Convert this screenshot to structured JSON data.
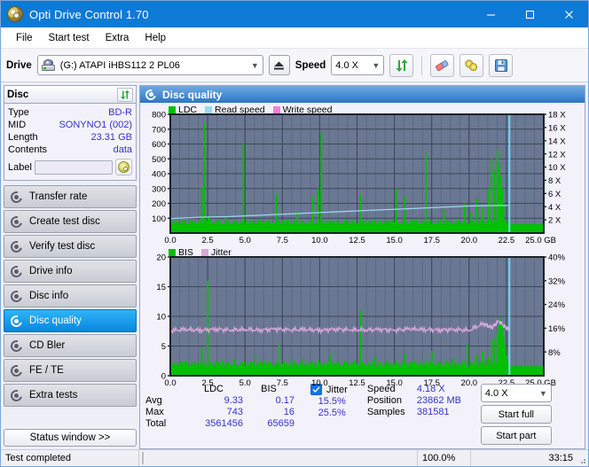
{
  "window": {
    "title": "Opti Drive Control 1.70",
    "icon": "disc-icon",
    "controls": {
      "minimize": "minimize-icon",
      "maximize": "maximize-icon",
      "close": "close-icon"
    }
  },
  "menubar": {
    "items": [
      "File",
      "Start test",
      "Extra",
      "Help"
    ]
  },
  "toolbar": {
    "drive_label": "Drive",
    "drive_value": "(G:)   ATAPI iHBS112  2 PL06",
    "eject_icon": "eject-icon",
    "speed_label": "Speed",
    "speed_value": "4.0 X",
    "refresh_icon": "refresh-icon",
    "eraser_icon": "eraser-icon",
    "settings_icon": "settings-icon",
    "save_icon": "save-icon"
  },
  "sidebar": {
    "disc_panel": {
      "title": "Disc",
      "refresh_icon": "refresh-icon",
      "rows": [
        {
          "key": "Type",
          "value": "BD-R"
        },
        {
          "key": "MID",
          "value": "SONYNO1 (002)"
        },
        {
          "key": "Length",
          "value": "23.31 GB"
        },
        {
          "key": "Contents",
          "value": "data"
        }
      ],
      "label_key": "Label",
      "label_value": "",
      "label_button_icon": "cd-icon"
    },
    "nav": [
      {
        "label": "Transfer rate",
        "icon": "disc-test-icon",
        "active": false
      },
      {
        "label": "Create test disc",
        "icon": "disc-test-icon",
        "active": false
      },
      {
        "label": "Verify test disc",
        "icon": "disc-test-icon",
        "active": false
      },
      {
        "label": "Drive info",
        "icon": "disc-test-icon",
        "active": false
      },
      {
        "label": "Disc info",
        "icon": "disc-test-icon",
        "active": false
      },
      {
        "label": "Disc quality",
        "icon": "disc-test-icon",
        "active": true
      },
      {
        "label": "CD Bler",
        "icon": "disc-test-icon",
        "active": false
      },
      {
        "label": "FE / TE",
        "icon": "disc-test-icon",
        "active": false
      },
      {
        "label": "Extra tests",
        "icon": "disc-test-icon",
        "active": false
      }
    ],
    "status_window_button": "Status window >>"
  },
  "panel": {
    "title": "Disc quality",
    "icon": "disc-test-icon"
  },
  "stats": {
    "col_headers": [
      "LDC",
      "BIS"
    ],
    "rows": [
      {
        "label": "Avg",
        "ldc": "9.33",
        "bis": "0.17"
      },
      {
        "label": "Max",
        "ldc": "743",
        "bis": "16"
      },
      {
        "label": "Total",
        "ldc": "3561456",
        "bis": "65659"
      }
    ],
    "jitter": {
      "label": "Jitter",
      "checked": true,
      "avg": "15.5%",
      "max": "25.5%"
    },
    "speed": {
      "key": "Speed",
      "value": "4.18 X"
    },
    "position": {
      "key": "Position",
      "value": "23862 MB"
    },
    "samples": {
      "key": "Samples",
      "value": "381581"
    },
    "speed_select": "4.0 X",
    "start_full": "Start full",
    "start_part": "Start part"
  },
  "statusbar": {
    "text": "Test completed",
    "percent": "100.0%",
    "progress_value": 100,
    "time": "33:15"
  },
  "colors": {
    "accent": "#0d7ad6",
    "ldc_green": "#00c000",
    "read_speed": "#9bd7f0",
    "write_speed": "#ff7ad9",
    "bis_green": "#00c000",
    "jitter_pink": "#d9a8d8",
    "plot_bg": "#6b7893",
    "grid": "#566176",
    "value_blue": "#3333cc",
    "progress_green": "#14b514"
  },
  "chart_data": [
    {
      "type": "line",
      "title": "Disc quality - LDC",
      "xlabel": "GB",
      "ylabel": "LDC",
      "xlim": [
        0,
        25
      ],
      "ylim": [
        0,
        800
      ],
      "xticks": [
        "0.0",
        "2.5",
        "5.0",
        "7.5",
        "10.0",
        "12.5",
        "15.0",
        "17.5",
        "20.0",
        "22.5",
        "25.0 GB"
      ],
      "yticks": [
        100,
        200,
        300,
        400,
        500,
        600,
        700,
        800
      ],
      "y2label": "Speed",
      "y2lim": [
        0,
        18
      ],
      "y2ticks": [
        "2 X",
        "4 X",
        "6 X",
        "8 X",
        "10 X",
        "12 X",
        "14 X",
        "16 X",
        "18 X"
      ],
      "grid": true,
      "legend": [
        {
          "name": "LDC",
          "color": "#00c000"
        },
        {
          "name": "Read speed",
          "color": "#9bd7f0"
        },
        {
          "name": "Write speed",
          "color": "#ff7ad9"
        }
      ],
      "series": [
        {
          "name": "LDC",
          "color": "#00c000",
          "kind": "spikes",
          "baseline": 60,
          "x": [
            0.1,
            0.3,
            0.5,
            0.7,
            0.9,
            1.1,
            1.3,
            1.5,
            1.7,
            1.9,
            2.1,
            2.25,
            2.4,
            2.55,
            2.7,
            2.9,
            3.1,
            3.3,
            3.5,
            3.7,
            3.9,
            4.1,
            4.3,
            4.5,
            4.7,
            4.9,
            5.1,
            5.3,
            5.5,
            5.7,
            5.9,
            6.1,
            6.3,
            6.5,
            6.7,
            6.9,
            7.1,
            7.3,
            7.5,
            7.7,
            7.9,
            8.1,
            8.3,
            8.5,
            8.7,
            8.9,
            9.1,
            9.3,
            9.5,
            9.7,
            9.9,
            10.1,
            10.3,
            10.5,
            10.7,
            10.9,
            11.1,
            11.3,
            11.5,
            11.7,
            11.9,
            12.1,
            12.3,
            12.5,
            12.7,
            12.9,
            13.1,
            13.3,
            13.5,
            13.7,
            13.9,
            14.1,
            14.3,
            14.5,
            14.7,
            14.9,
            15.1,
            15.3,
            15.5,
            15.7,
            15.9,
            16.1,
            16.3,
            16.5,
            16.7,
            16.9,
            17.1,
            17.3,
            17.5,
            17.7,
            17.9,
            18.1,
            18.3,
            18.5,
            18.7,
            18.9,
            19.1,
            19.3,
            19.5,
            19.7,
            19.9,
            20.1,
            20.3,
            20.5,
            20.7,
            20.9,
            21.1,
            21.3,
            21.5,
            21.7,
            21.9,
            22.0,
            22.1,
            22.2,
            22.3,
            22.4,
            22.5,
            22.6,
            22.7
          ],
          "values": [
            70,
            65,
            80,
            62,
            75,
            68,
            90,
            72,
            66,
            78,
            310,
            743,
            95,
            120,
            88,
            70,
            64,
            92,
            60,
            110,
            68,
            74,
            66,
            82,
            70,
            600,
            86,
            64,
            72,
            68,
            96,
            62,
            70,
            78,
            66,
            74,
            260,
            70,
            86,
            64,
            92,
            70,
            66,
            150,
            80,
            74,
            62,
            90,
            250,
            70,
            300,
            676,
            85,
            70,
            66,
            88,
            74,
            62,
            70,
            96,
            66,
            80,
            72,
            64,
            260,
            70,
            86,
            62,
            74,
            92,
            66,
            70,
            80,
            64,
            72,
            88,
            300,
            66,
            70,
            250,
            64,
            86,
            74,
            92,
            66,
            70,
            540,
            80,
            64,
            72,
            66,
            88,
            160,
            70,
            74,
            62,
            70,
            96,
            66,
            200,
            80,
            140,
            72,
            230,
            64,
            180,
            86,
            300,
            500,
            420,
            560,
            470,
            380,
            300,
            200
          ]
        },
        {
          "name": "Read speed",
          "color": "#9bd7f0",
          "kind": "line",
          "axis": "right",
          "x": [
            0.0,
            2.0,
            4.0,
            6.0,
            8.0,
            10.0,
            12.0,
            14.0,
            16.0,
            18.0,
            20.0,
            22.0,
            22.6
          ],
          "values": [
            2.2,
            2.4,
            2.5,
            2.7,
            2.9,
            3.1,
            3.3,
            3.5,
            3.7,
            3.9,
            4.1,
            4.18,
            4.18
          ]
        },
        {
          "name": "Write speed",
          "color": "#ff7ad9",
          "kind": "line",
          "axis": "right",
          "x": [],
          "values": []
        },
        {
          "name": "Test end marker",
          "color": "#6fd8f5",
          "kind": "vline",
          "x": [
            22.7
          ],
          "values": [
            18
          ]
        }
      ]
    },
    {
      "type": "line",
      "title": "Disc quality - BIS / Jitter",
      "xlabel": "GB",
      "ylabel": "BIS",
      "xlim": [
        0,
        25
      ],
      "ylim": [
        0,
        20
      ],
      "xticks": [
        "0.0",
        "2.5",
        "5.0",
        "7.5",
        "10.0",
        "12.5",
        "15.0",
        "17.5",
        "20.0",
        "22.5",
        "25.0 GB"
      ],
      "yticks": [
        0,
        5,
        10,
        15,
        20
      ],
      "y2label": "Jitter",
      "y2lim": [
        0,
        40
      ],
      "y2ticks": [
        "8%",
        "16%",
        "24%",
        "32%",
        "40%"
      ],
      "grid": true,
      "legend": [
        {
          "name": "BIS",
          "color": "#00c000"
        },
        {
          "name": "Jitter",
          "color": "#d9a8d8"
        }
      ],
      "series": [
        {
          "name": "BIS",
          "color": "#00c000",
          "kind": "spikes",
          "baseline": 1.6,
          "x": [
            0.1,
            0.3,
            0.5,
            0.7,
            0.9,
            1.1,
            1.3,
            1.5,
            1.7,
            1.9,
            2.1,
            2.3,
            2.5,
            2.7,
            2.9,
            3.1,
            3.3,
            3.5,
            3.7,
            3.9,
            4.1,
            4.3,
            4.5,
            4.7,
            4.9,
            5.1,
            5.3,
            5.5,
            5.7,
            5.9,
            6.1,
            6.3,
            6.5,
            6.7,
            6.9,
            7.1,
            7.3,
            7.5,
            7.7,
            7.9,
            8.1,
            8.3,
            8.5,
            8.7,
            8.9,
            9.1,
            9.3,
            9.5,
            9.7,
            9.9,
            10.1,
            10.3,
            10.5,
            10.7,
            10.9,
            11.1,
            11.3,
            11.5,
            11.7,
            11.9,
            12.1,
            12.3,
            12.5,
            12.7,
            12.9,
            13.1,
            13.3,
            13.5,
            13.7,
            13.9,
            14.1,
            14.3,
            14.5,
            14.7,
            14.9,
            15.1,
            15.3,
            15.5,
            15.7,
            15.9,
            16.1,
            16.3,
            16.5,
            16.7,
            16.9,
            17.1,
            17.3,
            17.5,
            17.7,
            17.9,
            18.1,
            18.3,
            18.5,
            18.7,
            18.9,
            19.1,
            19.3,
            19.5,
            19.7,
            19.9,
            20.1,
            20.3,
            20.5,
            20.7,
            20.9,
            21.1,
            21.3,
            21.5,
            21.7,
            21.9,
            22.0,
            22.1,
            22.2,
            22.3,
            22.4,
            22.5,
            22.6,
            22.7
          ],
          "values": [
            1.8,
            2.2,
            1.9,
            2.4,
            2.0,
            2.6,
            1.8,
            2.1,
            2.3,
            1.9,
            4.6,
            2.2,
            16.0,
            2.0,
            2.4,
            1.8,
            2.2,
            2.6,
            1.9,
            2.3,
            2.0,
            2.8,
            1.8,
            2.2,
            2.5,
            1.9,
            2.4,
            2.0,
            3.4,
            2.2,
            1.8,
            2.6,
            2.0,
            2.3,
            1.9,
            2.2,
            5.2,
            2.0,
            2.4,
            1.8,
            2.6,
            2.2,
            1.9,
            2.3,
            3.0,
            2.0,
            2.5,
            1.8,
            2.2,
            2.6,
            1.9,
            2.4,
            2.0,
            3.6,
            2.2,
            1.8,
            2.3,
            2.0,
            2.6,
            1.9,
            2.2,
            2.5,
            2.0,
            11.0,
            2.4,
            1.8,
            2.2,
            2.6,
            3.2,
            2.0,
            2.3,
            1.9,
            2.5,
            2.2,
            1.8,
            2.6,
            2.0,
            2.4,
            3.8,
            1.9,
            2.2,
            2.5,
            2.0,
            2.3,
            1.8,
            2.6,
            2.2,
            4.2,
            2.0,
            2.4,
            1.9,
            2.2,
            2.6,
            2.0,
            3.0,
            2.3,
            1.8,
            2.5,
            2.2,
            5.4,
            2.0,
            2.6,
            3.4,
            2.2,
            4.0,
            2.8,
            3.2,
            5.8,
            6.4,
            7.2,
            8.6,
            9.8,
            8.4,
            6.6,
            5.2,
            3.4
          ]
        },
        {
          "name": "Jitter",
          "color": "#d9a8d8",
          "kind": "line",
          "axis": "right",
          "avg": 15.5,
          "x": [
            0.0,
            1.0,
            2.0,
            3.0,
            4.0,
            5.0,
            6.0,
            7.0,
            8.0,
            9.0,
            10.0,
            11.0,
            12.0,
            13.0,
            14.0,
            15.0,
            16.0,
            17.0,
            18.0,
            19.0,
            20.0,
            21.0,
            21.5,
            22.0,
            22.5,
            22.7
          ],
          "values": [
            15.2,
            15.6,
            15.3,
            15.7,
            15.4,
            15.6,
            15.3,
            15.8,
            15.4,
            15.6,
            15.3,
            15.7,
            15.5,
            15.4,
            15.6,
            15.3,
            15.8,
            15.5,
            15.4,
            15.6,
            15.3,
            17.6,
            16.2,
            18.4,
            16.0,
            15.6
          ]
        },
        {
          "name": "Test end marker",
          "color": "#6fd8f5",
          "kind": "vline",
          "x": [
            22.7
          ],
          "values": [
            20
          ]
        }
      ]
    }
  ]
}
